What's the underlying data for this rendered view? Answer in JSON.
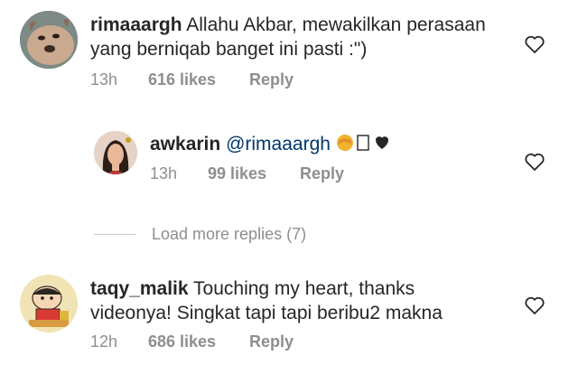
{
  "comments": [
    {
      "username": "rimaaargh",
      "text": "Allahu Akbar, mewakilkan perasaan yang berniqab banget ini pasti :\")",
      "time": "13h",
      "likes": "616 likes",
      "reply": "Reply",
      "avatar": "dog-photo"
    },
    {
      "username": "awkarin",
      "mention": "@rimaaargh",
      "emojis": "🙈💛❤",
      "time": "13h",
      "likes": "99 likes",
      "reply": "Reply",
      "avatar": "woman-portrait"
    },
    {
      "username": "taqy_malik",
      "text": "Touching my heart, thanks videonya! Singkat tapi tapi beribu2 makna",
      "time": "12h",
      "likes": "686 likes",
      "reply": "Reply",
      "avatar": "cartoon-character"
    }
  ],
  "load_more": "Load more replies (7)",
  "colors": {
    "text": "#262626",
    "muted": "#8e8e8e",
    "mention": "#00376b",
    "divider": "#c7c7c7"
  }
}
